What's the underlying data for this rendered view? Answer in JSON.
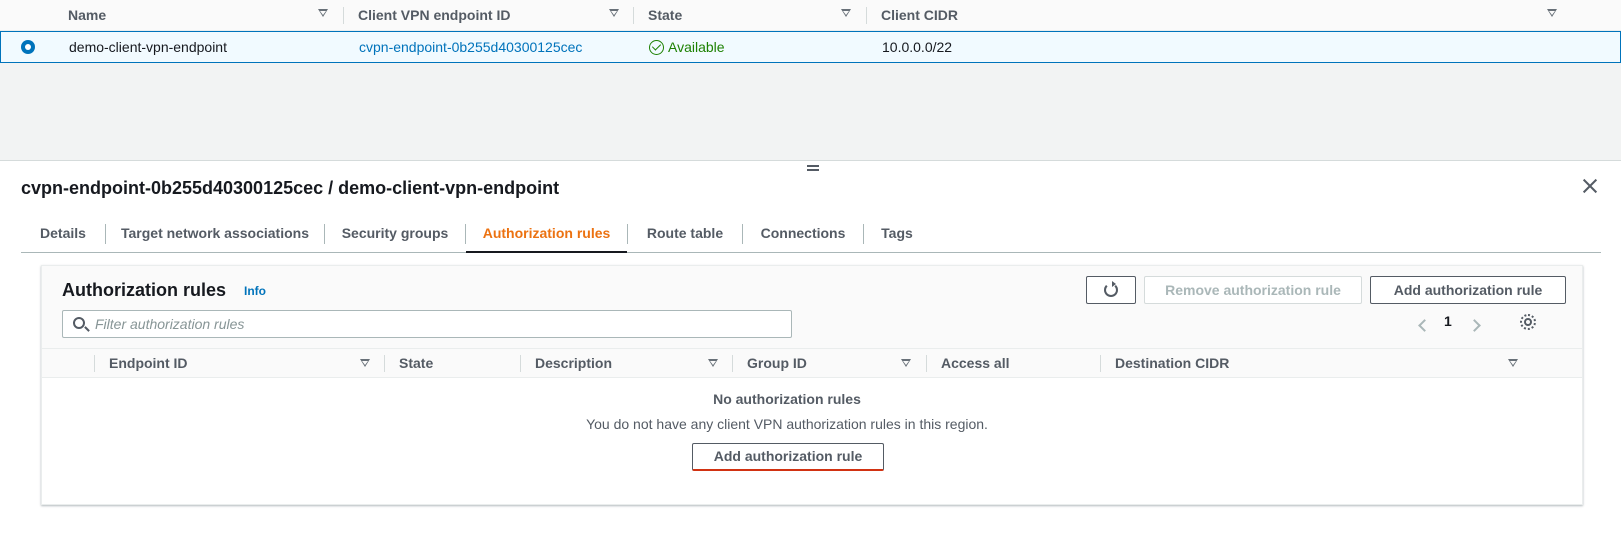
{
  "top_table": {
    "columns": [
      "Name",
      "Client VPN endpoint ID",
      "State",
      "Client CIDR"
    ],
    "row": {
      "name": "demo-client-vpn-endpoint",
      "endpoint_id": "cvpn-endpoint-0b255d40300125cec",
      "state": "Available",
      "cidr": "10.0.0.0/22"
    }
  },
  "split_panel": {
    "title": "cvpn-endpoint-0b255d40300125cec / demo-client-vpn-endpoint",
    "tabs": [
      {
        "label": "Details"
      },
      {
        "label": "Target network associations"
      },
      {
        "label": "Security groups"
      },
      {
        "label": "Authorization rules"
      },
      {
        "label": "Route table"
      },
      {
        "label": "Connections"
      },
      {
        "label": "Tags"
      }
    ],
    "active_tab": "Authorization rules"
  },
  "auth_rules": {
    "title": "Authorization rules",
    "info": "Info",
    "remove_button": "Remove authorization rule",
    "add_button": "Add authorization rule",
    "search_placeholder": "Filter authorization rules",
    "page": "1",
    "columns": [
      "Endpoint ID",
      "State",
      "Description",
      "Group ID",
      "Access all",
      "Destination CIDR"
    ],
    "empty_title": "No authorization rules",
    "empty_description": "You do not have any client VPN authorization rules in this region.",
    "empty_button": "Add authorization rule"
  },
  "colors": {
    "accent": "#0073bb",
    "active_tab": "#ec7211",
    "success": "#1d8102"
  }
}
